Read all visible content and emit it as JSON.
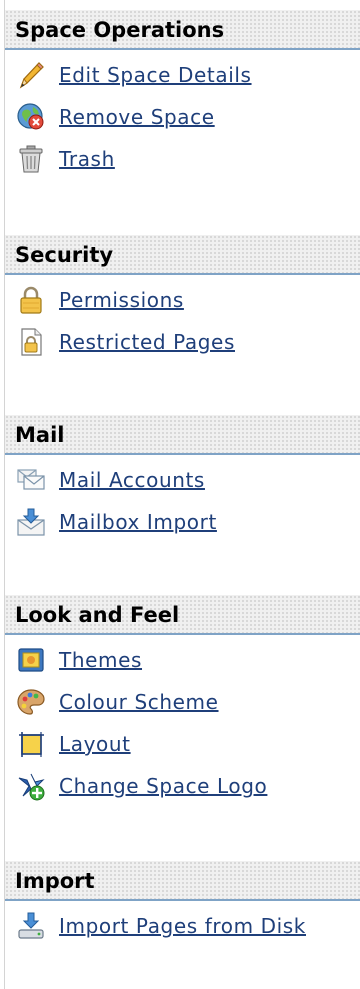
{
  "sections": [
    {
      "title": "Space Operations",
      "items": [
        {
          "label": "Edit Space Details",
          "icon": "pencil-icon"
        },
        {
          "label": "Remove Space",
          "icon": "remove-globe-icon"
        },
        {
          "label": "Trash",
          "icon": "trash-icon"
        }
      ]
    },
    {
      "title": "Security",
      "items": [
        {
          "label": "Permissions",
          "icon": "padlock-icon"
        },
        {
          "label": "Restricted Pages",
          "icon": "locked-page-icon"
        }
      ]
    },
    {
      "title": "Mail",
      "items": [
        {
          "label": "Mail Accounts",
          "icon": "mail-accounts-icon"
        },
        {
          "label": "Mailbox Import",
          "icon": "mailbox-import-icon"
        }
      ]
    },
    {
      "title": "Look and Feel",
      "items": [
        {
          "label": "Themes",
          "icon": "themes-icon"
        },
        {
          "label": "Colour Scheme",
          "icon": "palette-icon"
        },
        {
          "label": "Layout",
          "icon": "layout-icon"
        },
        {
          "label": "Change Space Logo",
          "icon": "change-logo-icon"
        }
      ]
    },
    {
      "title": "Import",
      "items": [
        {
          "label": "Import Pages from Disk",
          "icon": "import-disk-icon"
        }
      ]
    }
  ],
  "colors": {
    "link": "#1f3f7a",
    "header_rule": "#7fa3c6",
    "header_bg": "#f0f0f0"
  }
}
